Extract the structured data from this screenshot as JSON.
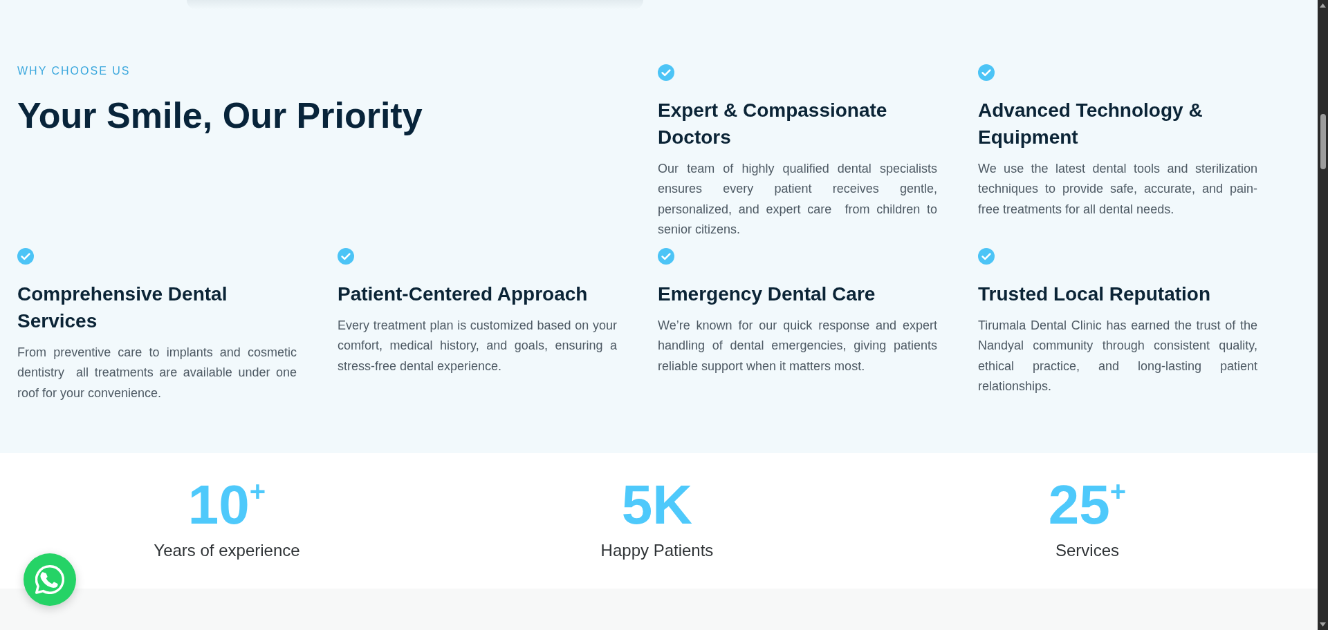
{
  "section": {
    "eyebrow": "WHY CHOOSE US",
    "heading": "Your Smile, Our Priority"
  },
  "features": [
    {
      "title": "Expert & Compassionate Doctors",
      "description": "Our team of highly qualified dental specialists ensures every patient receives gentle, personalized, and expert care  from children to senior citizens."
    },
    {
      "title": "Advanced Technology & Equipment",
      "description": "We use the latest dental tools and sterilization techniques to provide safe, accurate, and pain-free treatments for all dental needs."
    },
    {
      "title": "Comprehensive Dental Services",
      "description": "From preventive care to implants and cosmetic dentistry  all treatments are available under one roof for your convenience."
    },
    {
      "title": "Patient-Centered Approach",
      "description": "Every treatment plan is customized based on your comfort, medical history, and goals, ensuring a stress-free dental experience."
    },
    {
      "title": "Emergency Dental Care",
      "description": "We’re known for our quick response and expert handling of dental emergencies, giving patients reliable support when it matters most."
    },
    {
      "title": "Trusted Local Reputation",
      "description": "Tirumala Dental Clinic has earned the trust of the Nandyal community through consistent quality, ethical practice, and long-lasting patient relationships."
    }
  ],
  "stats": [
    {
      "number": "10$^{+}$",
      "label": "Years of experience"
    },
    {
      "number": "5K",
      "label": "Happy Patients"
    },
    {
      "number": "25$^{+}$",
      "label": "Services"
    }
  ]
}
